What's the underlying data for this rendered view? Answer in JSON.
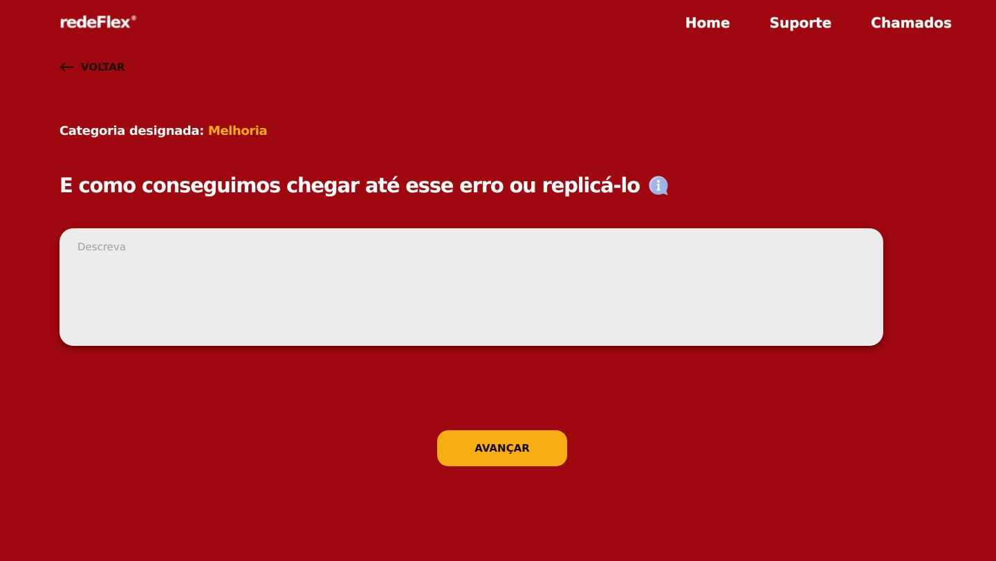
{
  "header": {
    "logo": {
      "text": "redeFlex",
      "registered_mark": "®"
    },
    "nav": [
      {
        "label": "Home"
      },
      {
        "label": "Suporte"
      },
      {
        "label": "Chamados"
      }
    ]
  },
  "back": {
    "label": "VOLTAR",
    "icon": "arrow-left-icon"
  },
  "category": {
    "label": "Categoria designada:",
    "value": "Melhoria"
  },
  "question": {
    "text": "E como conseguimos chegar até esse erro ou replicá-lo",
    "icon": "info-icon"
  },
  "description": {
    "placeholder": "Descreva",
    "value": ""
  },
  "actions": {
    "advance_label": "AVANÇAR"
  },
  "colors": {
    "background": "#9e080e",
    "accent": "#f6ae14",
    "input_background": "#ececec",
    "info_icon": "#9fb3e6"
  }
}
